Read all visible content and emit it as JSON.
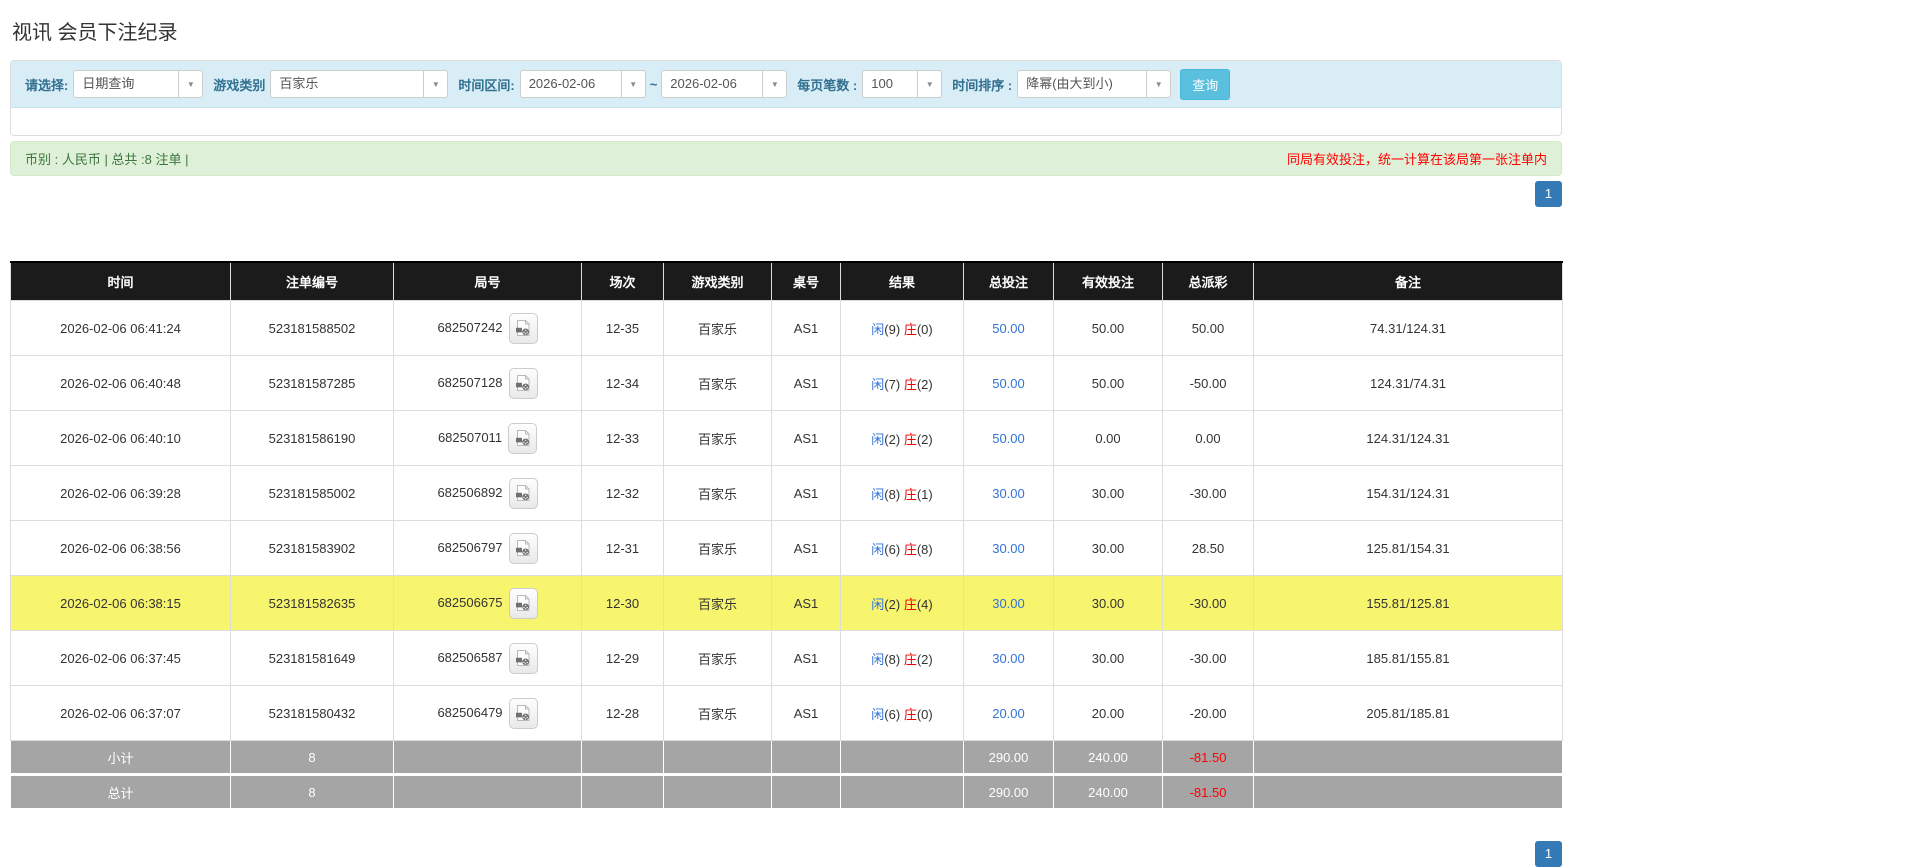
{
  "page_title": "视讯 会员下注纪录",
  "filter_bar": {
    "query_type_label": "请选择:",
    "query_type_value": "日期查询",
    "game_type_label": "游戏类别",
    "game_type_value": "百家乐",
    "time_range_label": "时间区间:",
    "date_from": "2026-02-06",
    "range_separator": "~",
    "date_to": "2026-02-06",
    "per_page_label": "每页笔数 :",
    "per_page_value": "100",
    "sort_label": "时间排序 :",
    "sort_value": "降幂(由大到小)",
    "search_button": "查询"
  },
  "summary_bar": {
    "currency_info": "币别 : 人民币 | 总共 :8 注单 |",
    "notice": "同局有效投注，统一计算在该局第一张注单内"
  },
  "pagination": {
    "current_page": "1"
  },
  "icons": {
    "chevron_down": "▼",
    "video_button": "video-record-icon"
  },
  "table": {
    "headers": [
      "时间",
      "注单编号",
      "局号",
      "场次",
      "游戏类别",
      "桌号",
      "结果",
      "总投注",
      "有效投注",
      "总派彩",
      "备注"
    ],
    "rows": [
      {
        "time": "2026-02-06 06:41:24",
        "bet_no": "523181588502",
        "round_no": "682507242",
        "session": "12-35",
        "game": "百家乐",
        "table_no": "AS1",
        "result": {
          "player_label": "闲",
          "player": "(9)",
          "banker_label": "庄",
          "banker": "(0)"
        },
        "total_bet": "50.00",
        "valid_bet": "50.00",
        "payout": "50.00",
        "remark": "74.31/124.31",
        "highlighted": false
      },
      {
        "time": "2026-02-06 06:40:48",
        "bet_no": "523181587285",
        "round_no": "682507128",
        "session": "12-34",
        "game": "百家乐",
        "table_no": "AS1",
        "result": {
          "player_label": "闲",
          "player": "(7)",
          "banker_label": "庄",
          "banker": "(2)"
        },
        "total_bet": "50.00",
        "valid_bet": "50.00",
        "payout": "-50.00",
        "remark": "124.31/74.31",
        "highlighted": false
      },
      {
        "time": "2026-02-06 06:40:10",
        "bet_no": "523181586190",
        "round_no": "682507011",
        "session": "12-33",
        "game": "百家乐",
        "table_no": "AS1",
        "result": {
          "player_label": "闲",
          "player": "(2)",
          "banker_label": "庄",
          "banker": "(2)"
        },
        "total_bet": "50.00",
        "valid_bet": "0.00",
        "payout": "0.00",
        "remark": "124.31/124.31",
        "highlighted": false
      },
      {
        "time": "2026-02-06 06:39:28",
        "bet_no": "523181585002",
        "round_no": "682506892",
        "session": "12-32",
        "game": "百家乐",
        "table_no": "AS1",
        "result": {
          "player_label": "闲",
          "player": "(8)",
          "banker_label": "庄",
          "banker": "(1)"
        },
        "total_bet": "30.00",
        "valid_bet": "30.00",
        "payout": "-30.00",
        "remark": "154.31/124.31",
        "highlighted": false
      },
      {
        "time": "2026-02-06 06:38:56",
        "bet_no": "523181583902",
        "round_no": "682506797",
        "session": "12-31",
        "game": "百家乐",
        "table_no": "AS1",
        "result": {
          "player_label": "闲",
          "player": "(6)",
          "banker_label": "庄",
          "banker": "(8)"
        },
        "total_bet": "30.00",
        "valid_bet": "30.00",
        "payout": "28.50",
        "remark": "125.81/154.31",
        "highlighted": false
      },
      {
        "time": "2026-02-06 06:38:15",
        "bet_no": "523181582635",
        "round_no": "682506675",
        "session": "12-30",
        "game": "百家乐",
        "table_no": "AS1",
        "result": {
          "player_label": "闲",
          "player": "(2)",
          "banker_label": "庄",
          "banker": "(4)"
        },
        "total_bet": "30.00",
        "valid_bet": "30.00",
        "payout": "-30.00",
        "remark": "155.81/125.81",
        "highlighted": true
      },
      {
        "time": "2026-02-06 06:37:45",
        "bet_no": "523181581649",
        "round_no": "682506587",
        "session": "12-29",
        "game": "百家乐",
        "table_no": "AS1",
        "result": {
          "player_label": "闲",
          "player": "(8)",
          "banker_label": "庄",
          "banker": "(2)"
        },
        "total_bet": "30.00",
        "valid_bet": "30.00",
        "payout": "-30.00",
        "remark": "185.81/155.81",
        "highlighted": false
      },
      {
        "time": "2026-02-06 06:37:07",
        "bet_no": "523181580432",
        "round_no": "682506479",
        "session": "12-28",
        "game": "百家乐",
        "table_no": "AS1",
        "result": {
          "player_label": "闲",
          "player": "(6)",
          "banker_label": "庄",
          "banker": "(0)"
        },
        "total_bet": "20.00",
        "valid_bet": "20.00",
        "payout": "-20.00",
        "remark": "205.81/185.81",
        "highlighted": false
      }
    ],
    "footer": [
      {
        "label": "小计",
        "count": "8",
        "total_bet": "290.00",
        "valid_bet": "240.00",
        "payout": "-81.50"
      },
      {
        "label": "总计",
        "count": "8",
        "total_bet": "290.00",
        "valid_bet": "240.00",
        "payout": "-81.50"
      }
    ]
  },
  "colors": {
    "filter_bar_bg": "#d9edf7",
    "filter_label_text": "#31708f",
    "search_button_bg": "#5bc0de",
    "summary_bar_bg": "#dff0d8",
    "summary_text_green": "#3c763d",
    "notice_text_red": "#ff0000",
    "table_header_bg": "#1b1b1b",
    "link_blue": "#3273d8",
    "player_blue": "#3273d8",
    "banker_red": "#ee0000",
    "negative_red": "#ee0000",
    "highlight_row_yellow": "#f7f46e",
    "footer_row_grey": "#a5a5a5",
    "pagination_active_bg": "#337ab7"
  }
}
